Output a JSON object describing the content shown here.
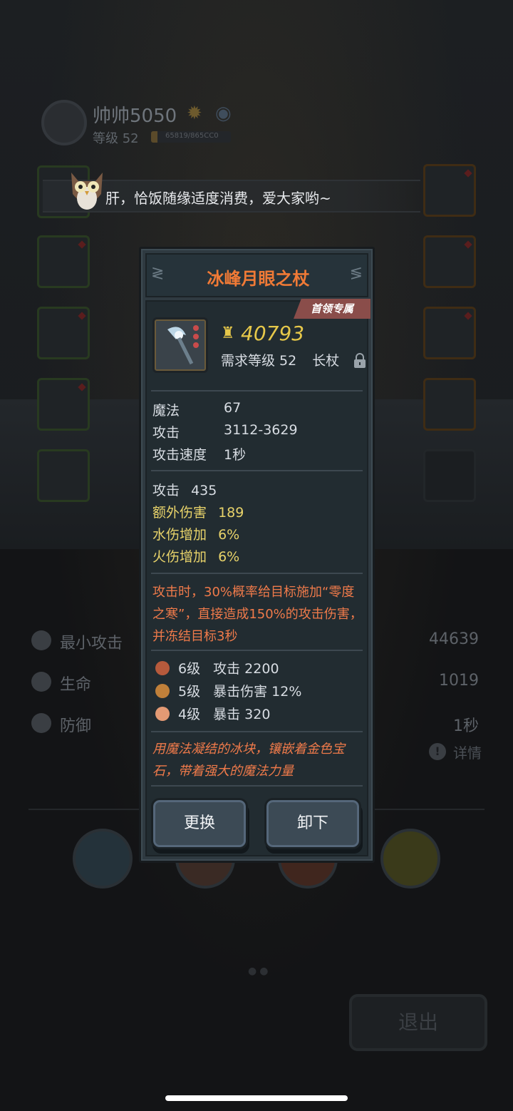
{
  "player": {
    "name": "帅帅5050",
    "level_label": "等级 52",
    "exp_text": "65819/865CC0",
    "exp_fraction": 0.08
  },
  "announcement": "肝，恰饭随缘适度消费，爱大家哟~",
  "stats_bg": [
    {
      "label": "最小攻击",
      "value": "44639",
      "icon": "sword-icon"
    },
    {
      "label": "生命",
      "value": "1019",
      "icon": "heart-icon"
    },
    {
      "label": "防御",
      "value": "1秒",
      "icon": "shield-icon"
    }
  ],
  "detail_link": "详情",
  "exit_label": "退出",
  "item": {
    "name": "冰峰月眼之杖",
    "tag": "首领专属",
    "price": "40793",
    "requirement": "需求等级 52",
    "type": "长杖",
    "base_stats": [
      {
        "label": "魔法",
        "value": "67"
      },
      {
        "label": "攻击",
        "value": "3112-3629"
      },
      {
        "label": "攻击速度",
        "value": "1秒"
      }
    ],
    "bonus_stats": [
      {
        "label": "攻击",
        "value": "435",
        "color": "#d8dde3"
      },
      {
        "label": "额外伤害",
        "value": "189",
        "color": "#e8d36a"
      },
      {
        "label": "水伤增加",
        "value": "6%",
        "color": "#e8d36a"
      },
      {
        "label": "火伤增加",
        "value": "6%",
        "color": "#e8d36a"
      }
    ],
    "skill_text": "攻击时，30%概率给目标施加“零度之寒”，直接造成150%的攻击伤害，并冻结目标3秒",
    "gems": [
      {
        "level": "6级",
        "effect": "攻击 2200",
        "color": "#b65a3c"
      },
      {
        "level": "5级",
        "effect": "暴击伤害 12%",
        "color": "#c0803a"
      },
      {
        "level": "4级",
        "effect": "暴击 320",
        "color": "#e39a74"
      }
    ],
    "flavor": "用魔法凝结的冰块，镶嵌着金色宝石，带着强大的魔法力量",
    "buttons": {
      "replace": "更换",
      "unequip": "卸下"
    }
  }
}
